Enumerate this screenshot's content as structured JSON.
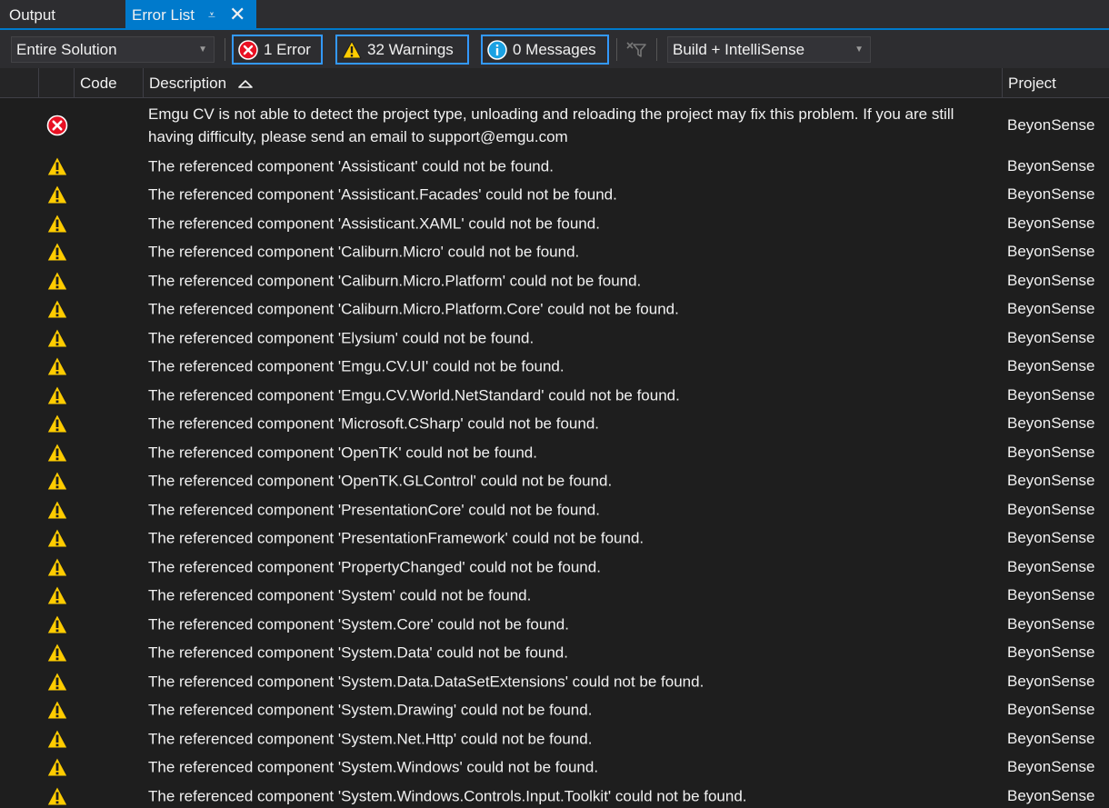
{
  "tabs": [
    {
      "label": "Output"
    },
    {
      "label": "Error List"
    }
  ],
  "toolbar": {
    "scope": "Entire Solution",
    "errors": "1 Error",
    "warnings": "32 Warnings",
    "messages": "0 Messages",
    "source": "Build + IntelliSense"
  },
  "columns": {
    "code": "Code",
    "description": "Description",
    "project": "Project"
  },
  "colors": {
    "accent": "#007acc",
    "error": "#e81123",
    "warning": "#ffcc00",
    "info": "#1ba1e2"
  },
  "rows": [
    {
      "type": "error",
      "description": "Emgu CV is not able to detect the project type, unloading and reloading the project may fix this problem. If you are still having difficulty, please send an email to support@emgu.com",
      "project": "BeyonSense"
    },
    {
      "type": "warning",
      "description": "The referenced component 'Assisticant' could not be found.",
      "project": "BeyonSense"
    },
    {
      "type": "warning",
      "description": "The referenced component 'Assisticant.Facades' could not be found.",
      "project": "BeyonSense"
    },
    {
      "type": "warning",
      "description": "The referenced component 'Assisticant.XAML' could not be found.",
      "project": "BeyonSense"
    },
    {
      "type": "warning",
      "description": "The referenced component 'Caliburn.Micro' could not be found.",
      "project": "BeyonSense"
    },
    {
      "type": "warning",
      "description": "The referenced component 'Caliburn.Micro.Platform' could not be found.",
      "project": "BeyonSense"
    },
    {
      "type": "warning",
      "description": "The referenced component 'Caliburn.Micro.Platform.Core' could not be found.",
      "project": "BeyonSense"
    },
    {
      "type": "warning",
      "description": "The referenced component 'Elysium' could not be found.",
      "project": "BeyonSense"
    },
    {
      "type": "warning",
      "description": "The referenced component 'Emgu.CV.UI' could not be found.",
      "project": "BeyonSense"
    },
    {
      "type": "warning",
      "description": "The referenced component 'Emgu.CV.World.NetStandard' could not be found.",
      "project": "BeyonSense"
    },
    {
      "type": "warning",
      "description": "The referenced component 'Microsoft.CSharp' could not be found.",
      "project": "BeyonSense"
    },
    {
      "type": "warning",
      "description": "The referenced component 'OpenTK' could not be found.",
      "project": "BeyonSense"
    },
    {
      "type": "warning",
      "description": "The referenced component 'OpenTK.GLControl' could not be found.",
      "project": "BeyonSense"
    },
    {
      "type": "warning",
      "description": "The referenced component 'PresentationCore' could not be found.",
      "project": "BeyonSense"
    },
    {
      "type": "warning",
      "description": "The referenced component 'PresentationFramework' could not be found.",
      "project": "BeyonSense"
    },
    {
      "type": "warning",
      "description": "The referenced component 'PropertyChanged' could not be found.",
      "project": "BeyonSense"
    },
    {
      "type": "warning",
      "description": "The referenced component 'System' could not be found.",
      "project": "BeyonSense"
    },
    {
      "type": "warning",
      "description": "The referenced component 'System.Core' could not be found.",
      "project": "BeyonSense"
    },
    {
      "type": "warning",
      "description": "The referenced component 'System.Data' could not be found.",
      "project": "BeyonSense"
    },
    {
      "type": "warning",
      "description": "The referenced component 'System.Data.DataSetExtensions' could not be found.",
      "project": "BeyonSense"
    },
    {
      "type": "warning",
      "description": "The referenced component 'System.Drawing' could not be found.",
      "project": "BeyonSense"
    },
    {
      "type": "warning",
      "description": "The referenced component 'System.Net.Http' could not be found.",
      "project": "BeyonSense"
    },
    {
      "type": "warning",
      "description": "The referenced component 'System.Windows' could not be found.",
      "project": "BeyonSense"
    },
    {
      "type": "warning",
      "description": "The referenced component 'System.Windows.Controls.Input.Toolkit' could not be found.",
      "project": "BeyonSense"
    }
  ]
}
